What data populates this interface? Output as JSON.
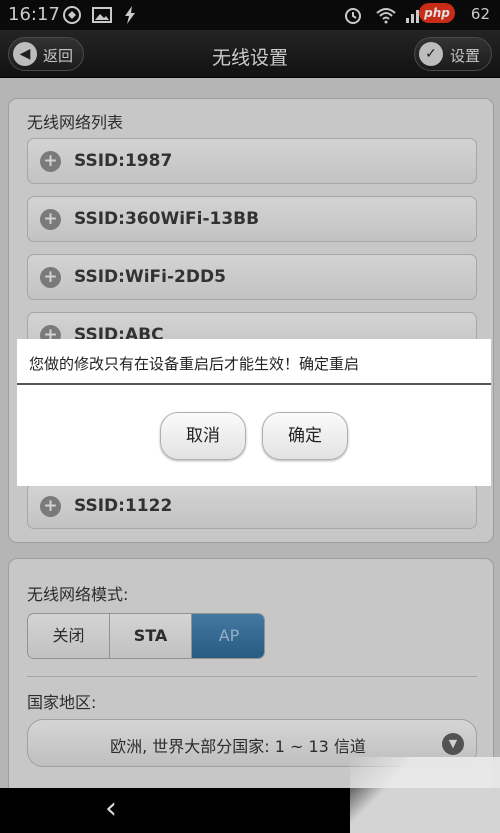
{
  "status_bar": {
    "time": "16:17",
    "battery": "62"
  },
  "php_badge": "php",
  "title_bar": {
    "title": "无线设置",
    "back_label": "返回",
    "settings_label": "设置"
  },
  "wifi_list": {
    "label": "无线网络列表",
    "items": [
      "SSID:1987",
      "SSID:360WiFi-13BB",
      "SSID:WiFi-2DD5",
      "SSID:ABC",
      "SSID:1122"
    ]
  },
  "mode": {
    "label": "无线网络模式:",
    "options": [
      "关闭",
      "STA",
      "AP"
    ],
    "selected": "AP"
  },
  "region": {
    "label": "国家地区:",
    "selected": "欧洲, 世界大部分国家: 1 ~ 13 信道"
  },
  "dialog": {
    "message": "您做的修改只有在设备重启后才能生效！确定重启",
    "cancel_label": "取消",
    "ok_label": "确定"
  },
  "colors": {
    "selected_segment": "#3b77a5",
    "php_badge": "#e4331b"
  }
}
